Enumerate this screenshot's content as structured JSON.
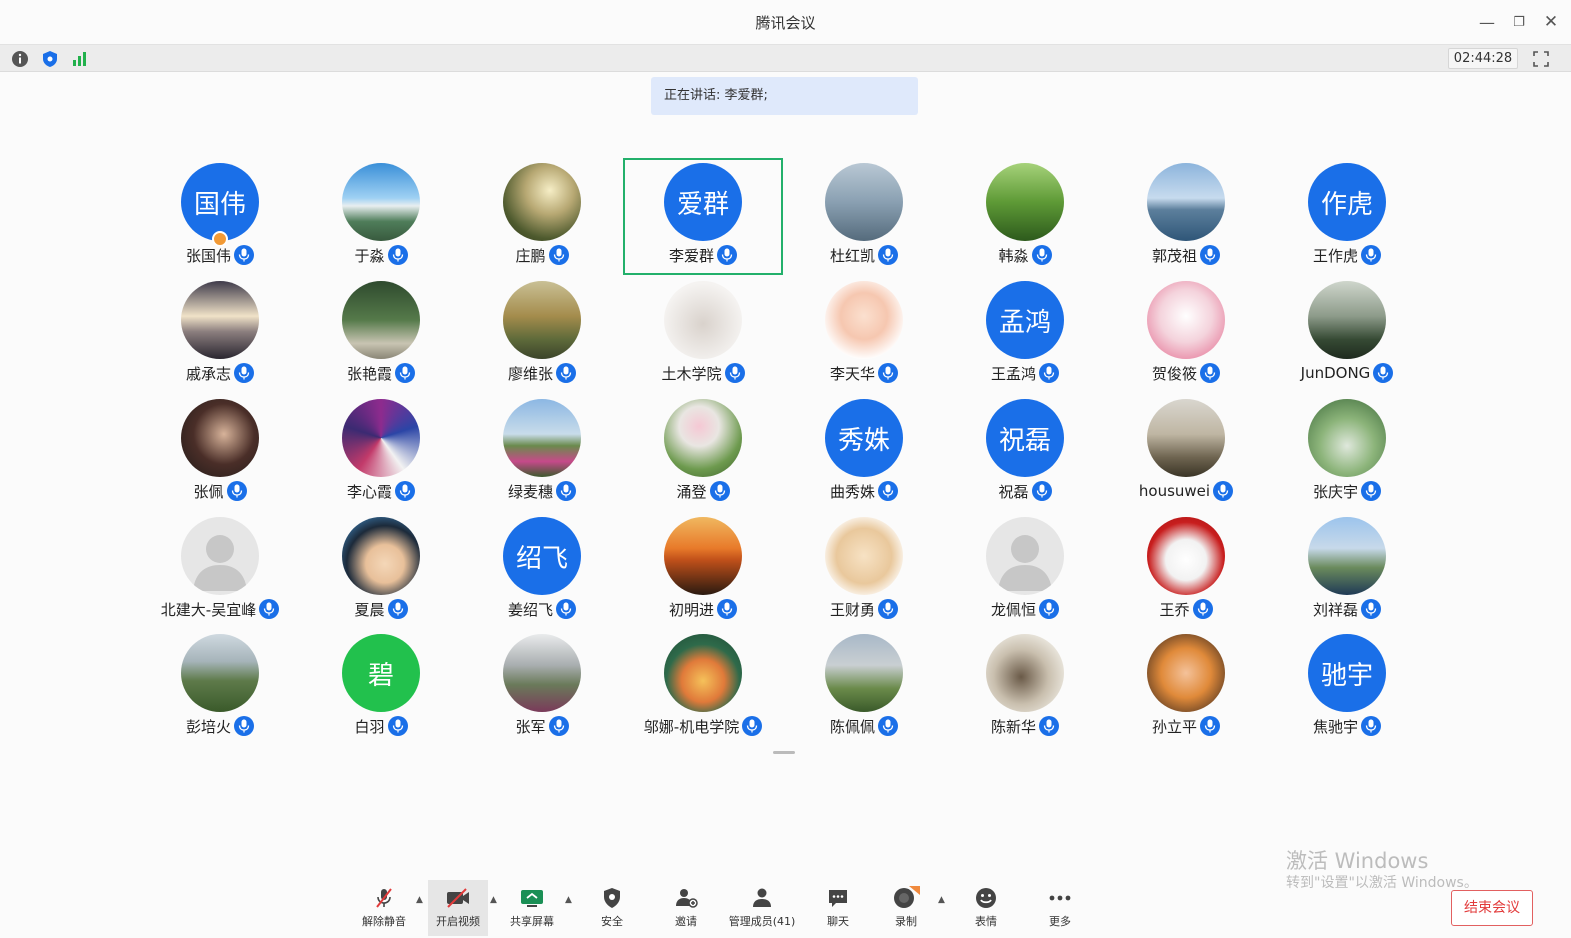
{
  "window": {
    "title": "腾讯会议",
    "minimize_glyph": "—",
    "maximize_glyph": "❐",
    "close_glyph": "✕"
  },
  "infostrip": {
    "icons": [
      "info-icon",
      "shield-icon",
      "signal-icon"
    ],
    "timer": "02:44:28"
  },
  "speaking_banner": "正在讲话: 李爱群;",
  "colors": {
    "accent": "#1a6fe8",
    "active_border": "#23b06b",
    "end_button": "#e23b3b"
  },
  "participants": [
    {
      "name": "张国伟",
      "avatar_text": "国伟",
      "avatar_kind": "text",
      "host": true
    },
    {
      "name": "于淼",
      "avatar_kind": "photo",
      "photo": "sky-lake"
    },
    {
      "name": "庄鹏",
      "avatar_kind": "photo",
      "photo": "forest-sun"
    },
    {
      "name": "李爱群",
      "avatar_text": "爱群",
      "avatar_kind": "text",
      "active": true
    },
    {
      "name": "杜红凯",
      "avatar_kind": "photo",
      "photo": "person-water"
    },
    {
      "name": "韩淼",
      "avatar_kind": "photo",
      "photo": "green-forest"
    },
    {
      "name": "郭茂祖",
      "avatar_kind": "photo",
      "photo": "city-lake"
    },
    {
      "name": "王作虎",
      "avatar_text": "作虎",
      "avatar_kind": "text"
    },
    {
      "name": "戚承志",
      "avatar_kind": "photo",
      "photo": "sunset-clouds"
    },
    {
      "name": "张艳霞",
      "avatar_kind": "photo",
      "photo": "person-park"
    },
    {
      "name": "廖维张",
      "avatar_kind": "photo",
      "photo": "autumn-trees"
    },
    {
      "name": "土木学院",
      "avatar_kind": "photo",
      "photo": "parent-child"
    },
    {
      "name": "李天华",
      "avatar_kind": "photo",
      "photo": "cartoon-baby"
    },
    {
      "name": "王孟鸿",
      "avatar_text": "孟鸿",
      "avatar_kind": "text"
    },
    {
      "name": "贺俊筱",
      "avatar_kind": "photo",
      "photo": "cat-pink"
    },
    {
      "name": "JunDONG",
      "avatar_kind": "photo",
      "photo": "pine-mountain"
    },
    {
      "name": "张佩",
      "avatar_kind": "photo",
      "photo": "woman-office"
    },
    {
      "name": "李心霞",
      "avatar_kind": "photo",
      "photo": "colorful-art"
    },
    {
      "name": "绿麦穗",
      "avatar_kind": "photo",
      "photo": "flower-field"
    },
    {
      "name": "涌登",
      "avatar_kind": "photo",
      "photo": "lotus"
    },
    {
      "name": "曲秀姝",
      "avatar_text": "秀姝",
      "avatar_kind": "text"
    },
    {
      "name": "祝磊",
      "avatar_text": "祝磊",
      "avatar_kind": "text"
    },
    {
      "name": "housuwei",
      "avatar_kind": "photo",
      "photo": "rock-tower"
    },
    {
      "name": "张庆宇",
      "avatar_kind": "photo",
      "photo": "totoro"
    },
    {
      "name": "北建大-吴宜峰",
      "avatar_kind": "default"
    },
    {
      "name": "夏晨",
      "avatar_kind": "photo",
      "photo": "cartoon-boy"
    },
    {
      "name": "姜绍飞",
      "avatar_text": "绍飞",
      "avatar_kind": "text"
    },
    {
      "name": "初明进",
      "avatar_kind": "photo",
      "photo": "sea-sunset"
    },
    {
      "name": "王财勇",
      "avatar_kind": "photo",
      "photo": "cartoon-kid"
    },
    {
      "name": "龙佩恒",
      "avatar_kind": "default"
    },
    {
      "name": "王乔",
      "avatar_kind": "photo",
      "photo": "bunny-red"
    },
    {
      "name": "刘祥磊",
      "avatar_kind": "photo",
      "photo": "man-outdoor"
    },
    {
      "name": "彭培火",
      "avatar_kind": "photo",
      "photo": "grass-building"
    },
    {
      "name": "白羽",
      "avatar_text": "碧",
      "avatar_kind": "green"
    },
    {
      "name": "张军",
      "avatar_kind": "photo",
      "photo": "dome-building"
    },
    {
      "name": "邬娜-机电学院",
      "avatar_kind": "photo",
      "photo": "cartoon-bear"
    },
    {
      "name": "陈佩佩",
      "avatar_kind": "photo",
      "photo": "green-hill"
    },
    {
      "name": "陈新华",
      "avatar_kind": "photo",
      "photo": "ink-painting"
    },
    {
      "name": "孙立平",
      "avatar_kind": "photo",
      "photo": "child-orange"
    },
    {
      "name": "焦驰宇",
      "avatar_text": "驰宇",
      "avatar_kind": "text"
    }
  ],
  "toolbar": {
    "unmute": "解除静音",
    "start_video": "开启视频",
    "share_screen": "共享屏幕",
    "security": "安全",
    "invite": "邀请",
    "manage_members": "管理成员(41)",
    "chat": "聊天",
    "record": "录制",
    "reactions": "表情",
    "more": "更多",
    "end_meeting": "结束会议"
  },
  "watermark": {
    "line1": "激活 Windows",
    "line2": "转到\"设置\"以激活 Windows。"
  }
}
